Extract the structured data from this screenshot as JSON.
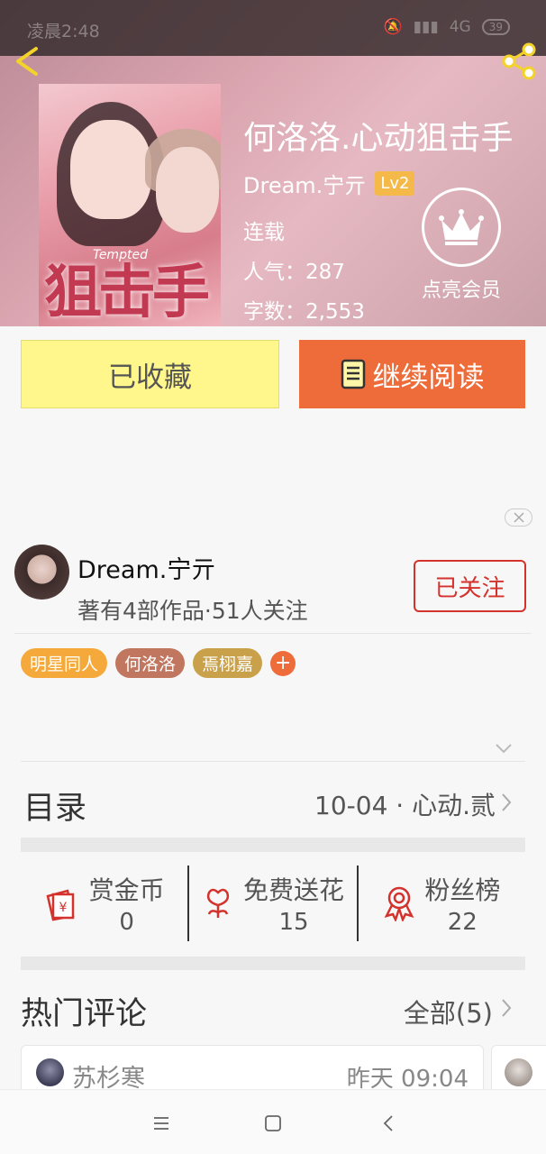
{
  "status_bar": {
    "time": "凌晨2:48",
    "network": "4G",
    "battery": "39"
  },
  "book": {
    "title": "何洛洛.心动狙击手",
    "author": "Dream.宁亓",
    "level": "Lv2",
    "status": "连载",
    "popularity": "人气：287",
    "word_count": "字数：2,553",
    "cover_text": "狙击手",
    "cover_script": "Tempted"
  },
  "vip": {
    "label": "点亮会员"
  },
  "actions": {
    "collected_label": "已收藏",
    "continue_label": "继续阅读"
  },
  "author_info": {
    "name": "Dream.宁亓",
    "stats": "著有4部作品·51人关注",
    "follow_label": "已关注"
  },
  "tags": [
    {
      "label": "明星同人",
      "color": "#f5a93a"
    },
    {
      "label": "何洛洛",
      "color": "#c0765f"
    },
    {
      "label": "焉栩嘉",
      "color": "#c8a14a"
    }
  ],
  "tag_add": "+",
  "catalog": {
    "title": "目录",
    "latest_chapter": "10-04 · 心动.贰"
  },
  "rewards": [
    {
      "label": "赏金币",
      "value": "0",
      "icon": "gift-envelope-icon"
    },
    {
      "label": "免费送花",
      "value": "15",
      "icon": "flower-icon"
    },
    {
      "label": "粉丝榜",
      "value": "22",
      "icon": "medal-icon"
    }
  ],
  "comments": {
    "title": "热门评论",
    "all_label": "全部(5)",
    "items": [
      {
        "user": "苏杉寒",
        "time": "昨天 09:04"
      }
    ]
  },
  "colors": {
    "accent_orange": "#ee6c3a",
    "collected_yellow": "#fff68c",
    "follow_red": "#d3322d",
    "level_badge": "#f5b94a"
  }
}
